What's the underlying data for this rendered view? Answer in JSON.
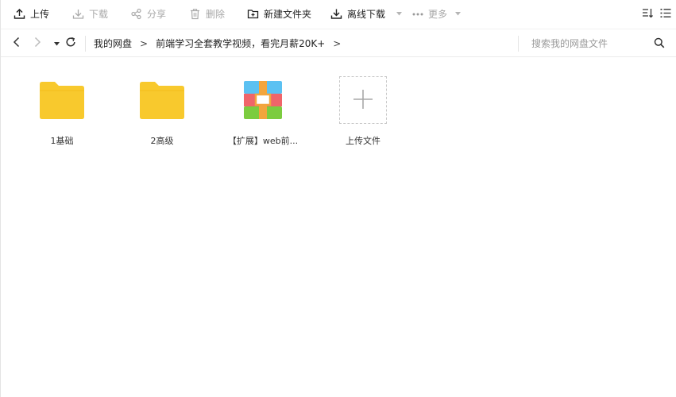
{
  "toolbar": {
    "upload": "上传",
    "download": "下载",
    "share": "分享",
    "delete": "删除",
    "new_folder": "新建文件夹",
    "offline_download": "离线下载",
    "more": "更多"
  },
  "nav": {
    "breadcrumbs": [
      "我的网盘",
      "前端学习全套教学视频，看完月薪20K+"
    ],
    "arrow": ">",
    "search_placeholder": "搜索我的网盘文件"
  },
  "files": [
    {
      "name": "1基础",
      "type": "folder"
    },
    {
      "name": "2高级",
      "type": "folder"
    },
    {
      "name": "【扩展】web前...",
      "type": "archive"
    },
    {
      "name": "上传文件",
      "type": "upload"
    }
  ],
  "colors": {
    "folder": "#f8c92d",
    "archive_blue": "#5bc1f2",
    "archive_red": "#f0656a",
    "archive_green": "#7ccc3f",
    "archive_band": "#f3a53d"
  }
}
